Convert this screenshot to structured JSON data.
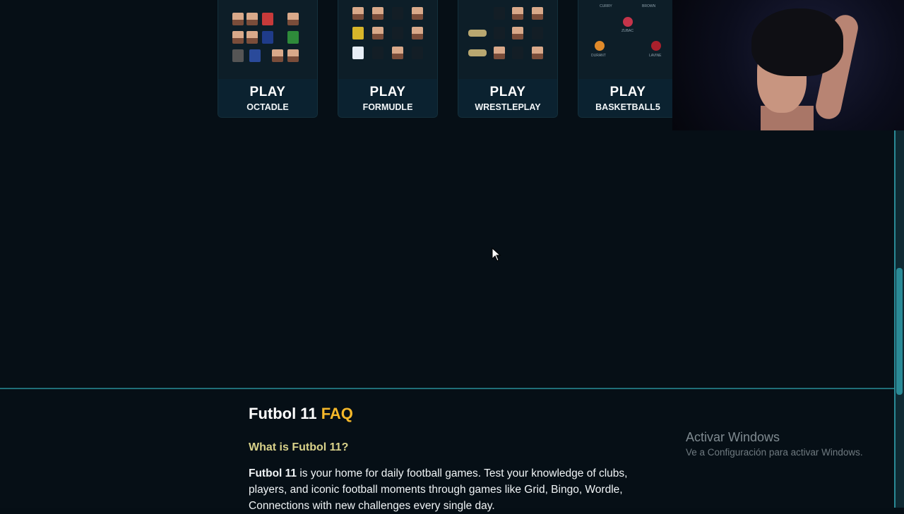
{
  "games": [
    {
      "play": "PLAY",
      "name": "OCTADLE"
    },
    {
      "play": "PLAY",
      "name": "FORMUDLE"
    },
    {
      "play": "PLAY",
      "name": "WRESTLEPLAY"
    },
    {
      "play": "PLAY",
      "name": "BASKETBALL5"
    }
  ],
  "basketball_labels": [
    "CURRY",
    "BROWN",
    "ZUBAC",
    "DURANT",
    "LAVINE"
  ],
  "faq": {
    "title_main": "Futbol 11",
    "title_accent": "FAQ",
    "question": "What is Futbol 11?",
    "answer_bold": "Futbol 11",
    "answer_rest": " is your home for daily football games. Test your knowledge of clubs, players, and iconic football moments through games like Grid, Bingo, Wordle, Connections with new challenges every single day."
  },
  "watermark": {
    "title": "Activar Windows",
    "subtitle": "Ve a Configuración para activar Windows."
  },
  "colors": {
    "background": "#060f16",
    "accent": "#f5b82a",
    "question": "#d9d28a",
    "divider": "#1f6f78"
  }
}
